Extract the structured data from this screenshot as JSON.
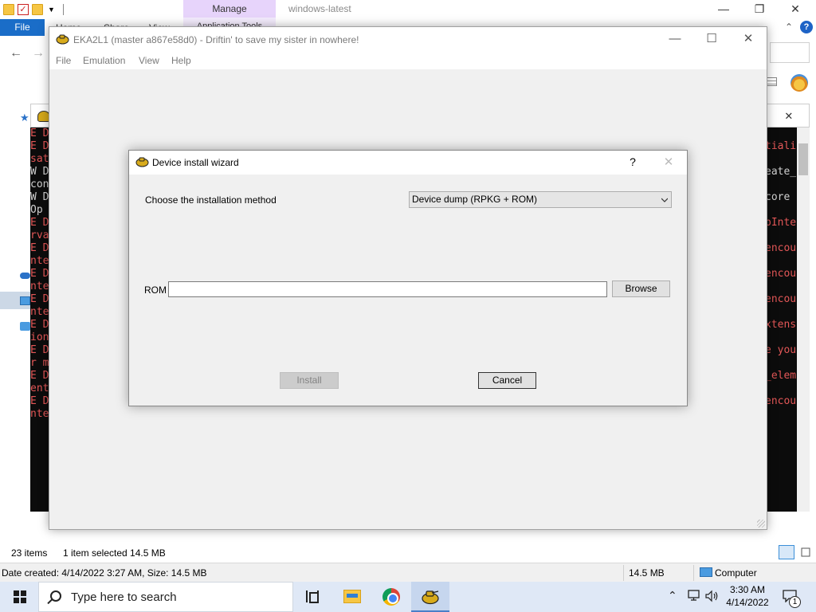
{
  "explorer": {
    "manage_tab": "Manage",
    "app_tools_tab": "Application Tools",
    "home_tab": "Home",
    "share_tab": "Share",
    "view_tab": "View",
    "title": "windows-latest",
    "file_tab": "File",
    "help": "?",
    "status": {
      "items_count": "23 items",
      "items_selected": "1 item selected  14.5 MB",
      "info": "Date created: 4/14/2022 3:27 AM, Size: 14.5 MB",
      "size": "14.5 MB",
      "computer": "Computer"
    }
  },
  "console": {
    "left_lines": [
      {
        "t": "E D",
        "c": "red"
      },
      {
        "t": "E D",
        "c": "red"
      },
      {
        "t": "sat",
        "c": "red"
      },
      {
        "t": "W D",
        "c": "wht"
      },
      {
        "t": "con",
        "c": "wht"
      },
      {
        "t": "W D",
        "c": "wht"
      },
      {
        "t": " Op",
        "c": "wht"
      },
      {
        "t": "E D",
        "c": "red"
      },
      {
        "t": "rva",
        "c": "red"
      },
      {
        "t": "E D",
        "c": "red"
      },
      {
        "t": "nte",
        "c": "red"
      },
      {
        "t": "E D",
        "c": "red"
      },
      {
        "t": "nte",
        "c": "red"
      },
      {
        "t": "E D",
        "c": "red"
      },
      {
        "t": "nte",
        "c": "red"
      },
      {
        "t": "E D",
        "c": "red"
      },
      {
        "t": "ion",
        "c": "red"
      },
      {
        "t": "E D",
        "c": "red"
      },
      {
        "t": "r m",
        "c": "red"
      },
      {
        "t": "E D",
        "c": "red"
      },
      {
        "t": "ent",
        "c": "red"
      },
      {
        "t": "E D",
        "c": "red"
      },
      {
        "t": "nte",
        "c": "red"
      }
    ],
    "right_lines": [
      {
        "t": "",
        "c": "red"
      },
      {
        "t": "tiali",
        "c": "red"
      },
      {
        "t": "",
        "c": "red"
      },
      {
        "t": "eate_",
        "c": "wht"
      },
      {
        "t": "",
        "c": "red"
      },
      {
        "t": " core",
        "c": "wht"
      },
      {
        "t": "",
        "c": "red"
      },
      {
        "t": "pInte",
        "c": "red"
      },
      {
        "t": "",
        "c": "red"
      },
      {
        "t": "encou",
        "c": "red"
      },
      {
        "t": "",
        "c": "red"
      },
      {
        "t": "encou",
        "c": "red"
      },
      {
        "t": "",
        "c": "red"
      },
      {
        "t": "encou",
        "c": "red"
      },
      {
        "t": "",
        "c": "red"
      },
      {
        "t": "xtens",
        "c": "red"
      },
      {
        "t": "",
        "c": "red"
      },
      {
        "t": "e you",
        "c": "red"
      },
      {
        "t": "",
        "c": "red"
      },
      {
        "t": "_elem",
        "c": "red"
      },
      {
        "t": "",
        "c": "red"
      },
      {
        "t": "encou",
        "c": "red"
      }
    ]
  },
  "eka": {
    "title": "EKA2L1 (master a867e58d0) - Driftin' to save my sister in nowhere!",
    "menu": {
      "file": "File",
      "emulation": "Emulation",
      "view": "View",
      "help": "Help"
    }
  },
  "dialog": {
    "title": "Device install wizard",
    "help": "?",
    "method_label": "Choose the installation method",
    "method_value": "Device dump (RPKG + ROM)",
    "rom_label": "ROM",
    "rom_value": "",
    "browse_label": "Browse",
    "install_label": "Install",
    "cancel_label": "Cancel"
  },
  "taskbar": {
    "search_placeholder": "Type here to search",
    "time": "3:30 AM",
    "date": "4/14/2022",
    "notification_count": "1"
  },
  "colors": {
    "accent": "#1a6dc8",
    "console_error": "#e35757",
    "manage_tab": "#e7d4fb"
  }
}
